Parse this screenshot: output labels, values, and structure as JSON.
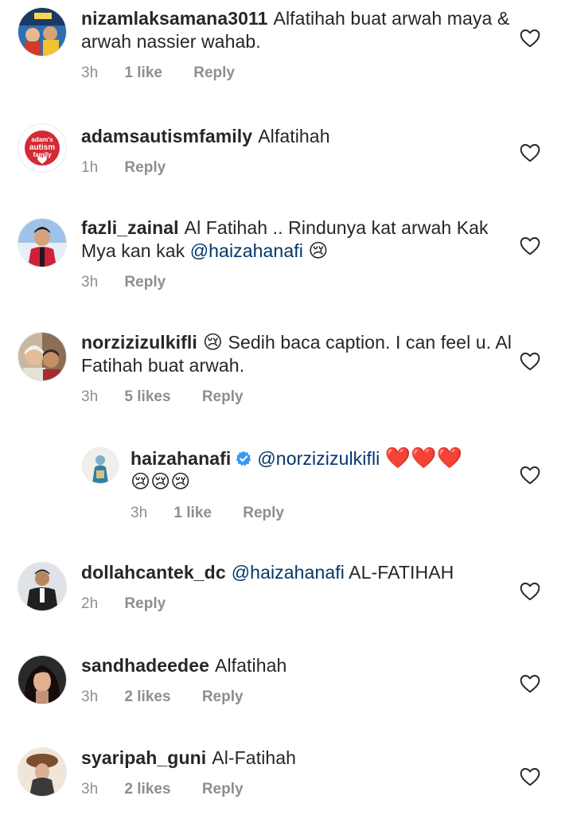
{
  "comments": [
    {
      "username": "nizamlaksamana3011",
      "text": "Alfatihah buat arwah maya & arwah nassier wahab.",
      "time": "3h",
      "likes": "1 like",
      "reply_label": "Reply"
    },
    {
      "username": "adamsautismfamily",
      "text": "Alfatihah",
      "time": "1h",
      "likes": "",
      "reply_label": "Reply"
    },
    {
      "username": "fazli_zainal",
      "text": "Al Fatihah .. Rindunya kat arwah Kak Mya kan kak",
      "mention": "@haizahanafi",
      "emoji": "😢",
      "time": "3h",
      "likes": "",
      "reply_label": "Reply"
    },
    {
      "username": "norzizizulkifli",
      "emoji": "😢",
      "text": "Sedih baca caption. I can feel u. Al Fatihah buat arwah.",
      "time": "3h",
      "likes": "5 likes",
      "reply_label": "Reply"
    },
    {
      "username": "haizahanafi",
      "mention": "@norzizizulkifli",
      "emoji_line": "❤️❤️❤️",
      "emoji_line2": "😢😢😢",
      "time": "3h",
      "likes": "1 like",
      "reply_label": "Reply"
    },
    {
      "username": "dollahcantek_dc",
      "mention": "@haizahanafi",
      "text": "AL-FATIHAH",
      "time": "2h",
      "likes": "",
      "reply_label": "Reply"
    },
    {
      "username": "sandhadeedee",
      "text": "Alfatihah",
      "time": "3h",
      "likes": "2 likes",
      "reply_label": "Reply"
    },
    {
      "username": "syaripah_guni",
      "text": "Al-Fatihah",
      "time": "3h",
      "likes": "2 likes",
      "reply_label": "Reply"
    }
  ],
  "avatar_text": {
    "adams": "adam's autism family"
  },
  "colors": {
    "text": "#262626",
    "meta": "#8e8e8e",
    "mention": "#00376b",
    "verified": "#3897f0",
    "heart_emoji": "#e0243b"
  },
  "icons": {
    "like": "heart-outline-icon",
    "verified": "verified-badge-icon"
  }
}
